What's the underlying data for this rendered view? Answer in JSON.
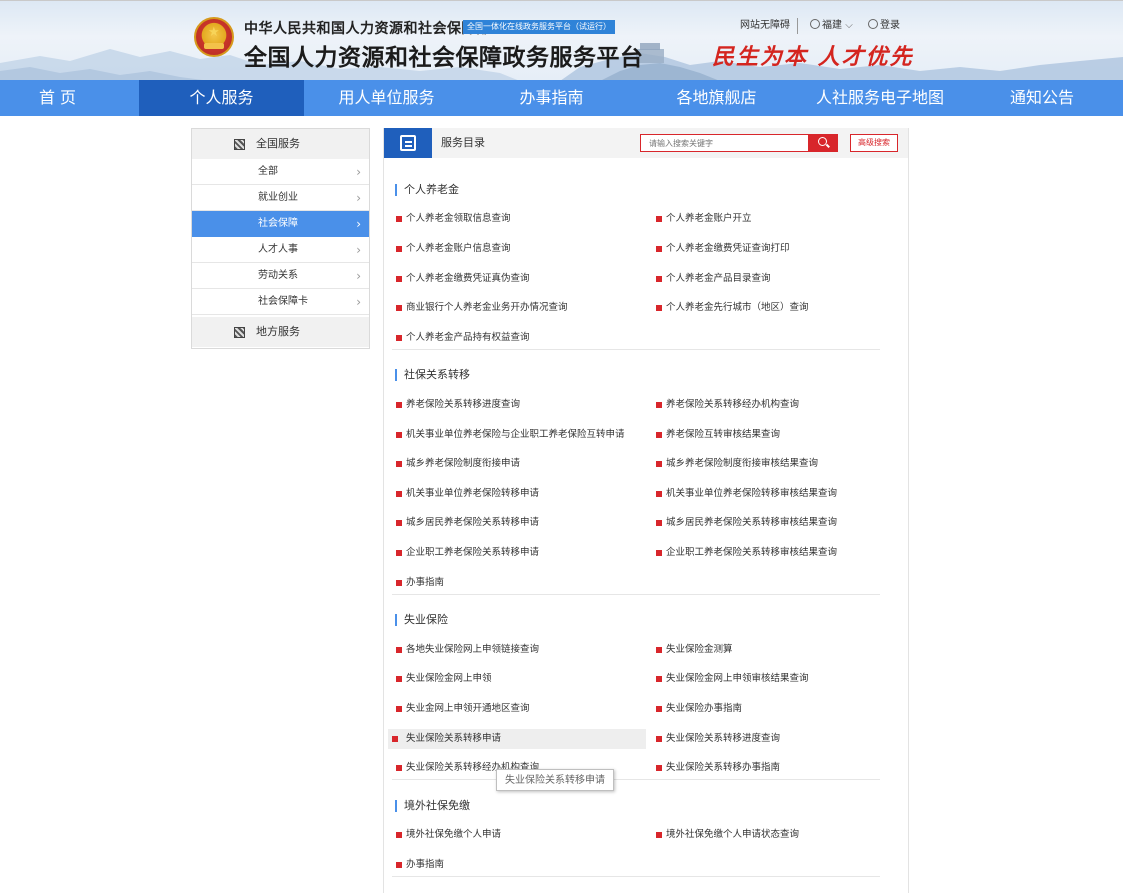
{
  "header": {
    "ministry": "中华人民共和国人力资源和社会保障部",
    "badge": "全国一体化在线政务服务平台（试运行）",
    "portal_title": "全国人力资源和社会保障政务服务平台",
    "accessibility": "网站无障碍",
    "region": "福建",
    "region_chevron": "⌵",
    "login": "登录",
    "slogan": "民生为本 人才优先"
  },
  "nav": {
    "items": [
      "首 页",
      "个人服务",
      "用人单位服务",
      "办事指南",
      "各地旗舰店",
      "人社服务电子地图",
      "通知公告"
    ],
    "active": "个人服务"
  },
  "sidebar": {
    "national_label": "全国服务",
    "local_label": "地方服务",
    "items": [
      "全部",
      "就业创业",
      "社会保障",
      "人才人事",
      "劳动关系",
      "社会保障卡"
    ],
    "active_item": "社会保障",
    "chevron": "›"
  },
  "main": {
    "catalog_title": "服务目录",
    "search_placeholder": "请输入搜索关键字",
    "advanced_search": "高级搜索",
    "sections": [
      {
        "title": "个人养老金",
        "items": [
          "个人养老金领取信息查询",
          "个人养老金账户开立",
          "个人养老金账户信息查询",
          "个人养老金缴费凭证查询打印",
          "个人养老金缴费凭证真伪查询",
          "个人养老金产品目录查询",
          "商业银行个人养老金业务开办情况查询",
          "个人养老金先行城市（地区）查询",
          "个人养老金产品持有权益查询"
        ]
      },
      {
        "title": "社保关系转移",
        "items": [
          "养老保险关系转移进度查询",
          "养老保险关系转移经办机构查询",
          "机关事业单位养老保险与企业职工养老保险互转申请",
          "养老保险互转审核结果查询",
          "城乡养老保险制度衔接申请",
          "城乡养老保险制度衔接审核结果查询",
          "机关事业单位养老保险转移申请",
          "机关事业单位养老保险转移审核结果查询",
          "城乡居民养老保险关系转移申请",
          "城乡居民养老保险关系转移审核结果查询",
          "企业职工养老保险关系转移申请",
          "企业职工养老保险关系转移审核结果查询",
          "办事指南"
        ]
      },
      {
        "title": "失业保险",
        "items": [
          "各地失业保险网上申领链接查询",
          "失业保险金测算",
          "失业保险金网上申领",
          "失业保险金网上申领审核结果查询",
          "失业金网上申领开通地区查询",
          "失业保险办事指南",
          "失业保险关系转移申请",
          "失业保险关系转移进度查询",
          "失业保险关系转移经办机构查询",
          "失业保险关系转移办事指南"
        ]
      },
      {
        "title": "境外社保免缴",
        "items": [
          "境外社保免缴个人申请",
          "境外社保免缴个人申请状态查询",
          "办事指南"
        ]
      }
    ],
    "hovered_item": "失业保险关系转移申请",
    "tooltip": "失业保险关系转移申请"
  }
}
